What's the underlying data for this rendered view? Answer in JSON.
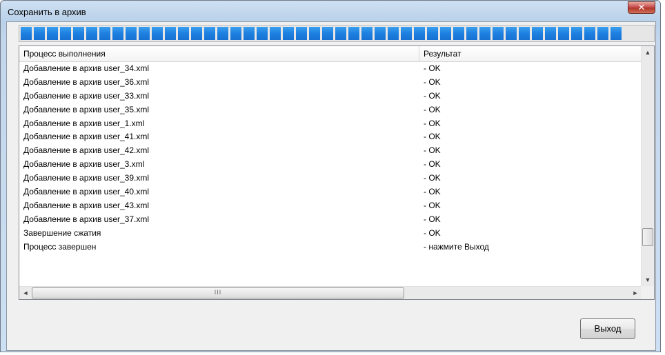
{
  "window": {
    "title": "Сохранить в архив",
    "close_label": "✕"
  },
  "progress": {
    "fraction": 1.0,
    "segments": 46
  },
  "table": {
    "columns": [
      "Процесс выполнения",
      "Результат"
    ],
    "rows": [
      [
        "Добавление в архив user_34.xml",
        "- OK"
      ],
      [
        "Добавление в архив user_36.xml",
        "- OK"
      ],
      [
        "Добавление в архив user_33.xml",
        "- OK"
      ],
      [
        "Добавление в архив user_35.xml",
        "- OK"
      ],
      [
        "Добавление в архив user_1.xml",
        "- OK"
      ],
      [
        "Добавление в архив user_41.xml",
        "- OK"
      ],
      [
        "Добавление в архив user_42.xml",
        "- OK"
      ],
      [
        "Добавление в архив user_3.xml",
        "- OK"
      ],
      [
        "Добавление в архив user_39.xml",
        "- OK"
      ],
      [
        "Добавление в архив user_40.xml",
        "- OK"
      ],
      [
        "Добавление в архив user_43.xml",
        "- OK"
      ],
      [
        "Добавление в архив user_37.xml",
        "- OK"
      ],
      [
        "Завершение сжатия",
        "- OK"
      ],
      [
        "Процесс завершен",
        "- нажмите Выход"
      ]
    ]
  },
  "scrollbars": {
    "up_icon": "▲",
    "down_icon": "▼",
    "left_icon": "◄",
    "right_icon": "►",
    "h_thumb_grip": "III"
  },
  "buttons": {
    "exit_label": "Выход"
  }
}
